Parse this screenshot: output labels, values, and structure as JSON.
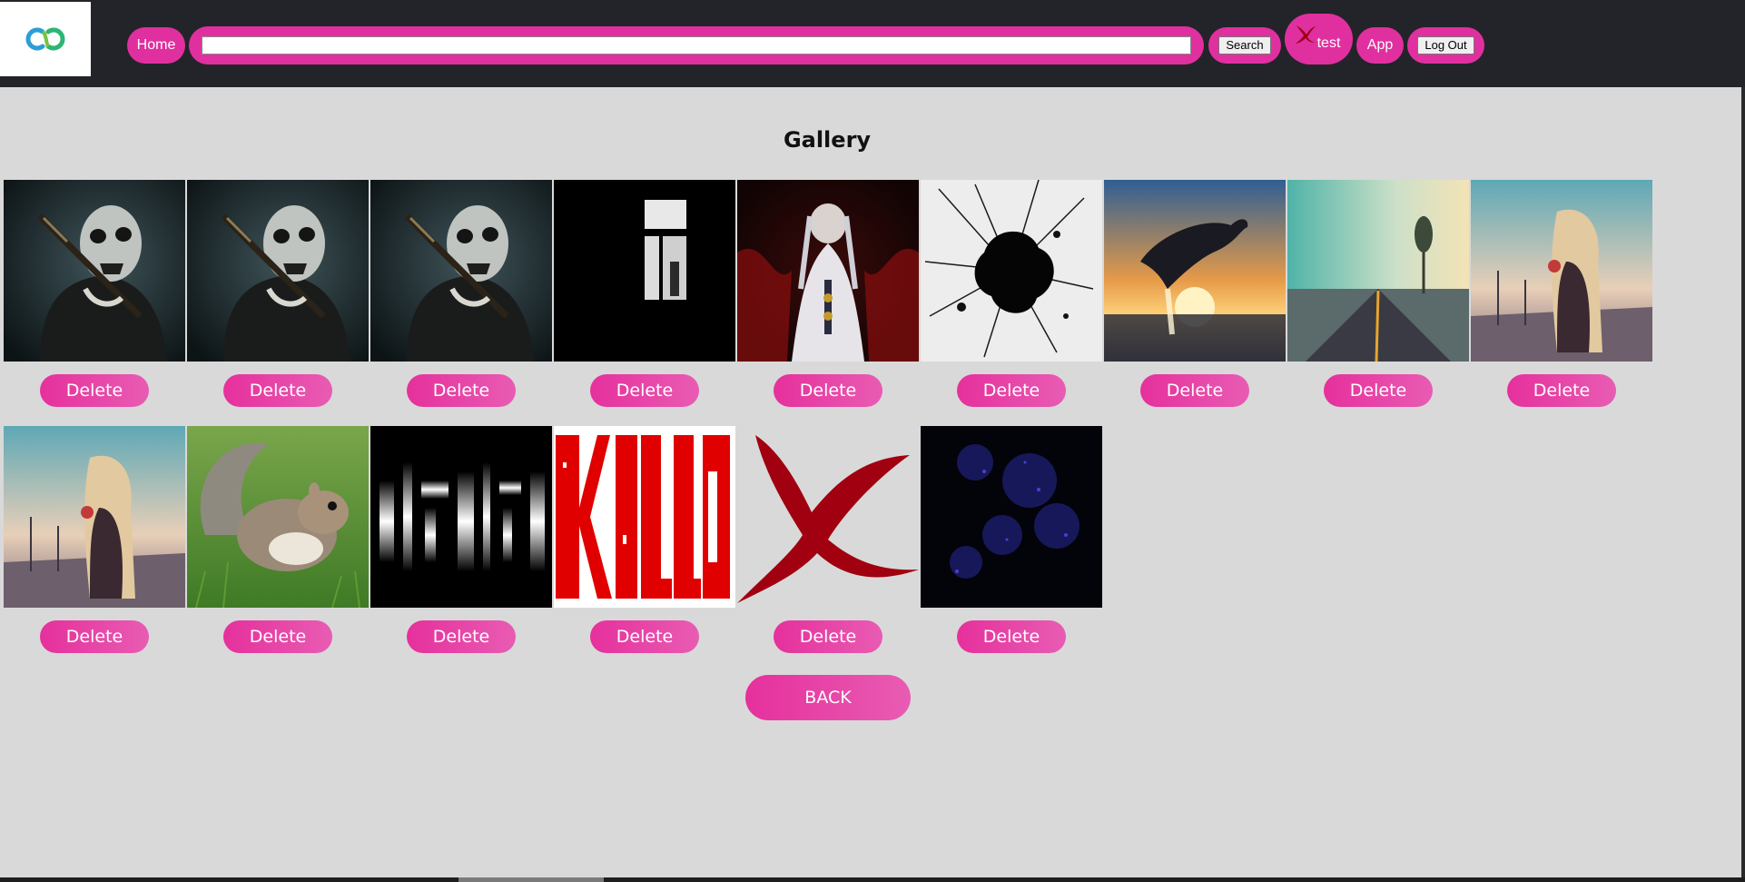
{
  "nav": {
    "home_label": "Home",
    "search": {
      "value": "",
      "placeholder": ""
    },
    "search_button_label": "Search",
    "user_label": "test",
    "app_label": "App",
    "logout_label": "Log Out"
  },
  "colors": {
    "accent": "#e0309f",
    "topbar": "#232429",
    "page_bg": "#d9d9d9"
  },
  "page": {
    "title": "Gallery",
    "back_label": "BACK"
  },
  "gallery": {
    "delete_label": "Delete",
    "items": [
      {
        "picture": "skull-face-man-with-gun"
      },
      {
        "picture": "skull-face-man-with-gun"
      },
      {
        "picture": "skull-face-man-with-gun"
      },
      {
        "picture": "dark-window-figure"
      },
      {
        "picture": "white-robed-anime-figure"
      },
      {
        "picture": "black-ink-splat"
      },
      {
        "picture": "dolphin-sunset"
      },
      {
        "picture": "misty-road-tree"
      },
      {
        "picture": "girl-long-hair-sunset"
      },
      {
        "picture": "girl-long-hair-sunset"
      },
      {
        "picture": "squirrel-on-grass"
      },
      {
        "picture": "black-white-glitch-text"
      },
      {
        "picture": "killed-red-text"
      },
      {
        "picture": "red-x-mark"
      },
      {
        "picture": "dark-blue-noise"
      }
    ]
  }
}
